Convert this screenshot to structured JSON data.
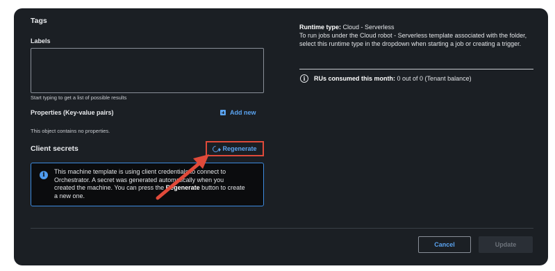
{
  "tags": {
    "title": "Tags"
  },
  "labels": {
    "title": "Labels",
    "hint": "Start typing to get a list of possible results"
  },
  "properties": {
    "title": "Properties (Key-value pairs)",
    "add_label": "Add new",
    "empty_text": "This object contains no properties."
  },
  "client_secrets": {
    "title": "Client secrets",
    "regenerate_label": "Regenerate",
    "info_line1": "This machine template is using client credentials to connect to",
    "info_line2": "Orchestrator. A secret was generated automatically when you",
    "info_line3_pre": "created the machine. You can press the ",
    "info_line3_bold": "Regenerate",
    "info_line3_post": " button to create",
    "info_line4": "a new one."
  },
  "runtime": {
    "label": "Runtime type:",
    "value": "Cloud - Serverless",
    "description": "To run jobs under the Cloud robot - Serverless template associated with the folder, select this runtime type in the dropdown when starting a job or creating a trigger."
  },
  "rus": {
    "label": "RUs consumed this month:",
    "value": "0 out of 0 (Tenant balance)"
  },
  "footer": {
    "cancel_label": "Cancel",
    "update_label": "Update"
  },
  "colors": {
    "panel_bg": "#1b1f24",
    "accent": "#5aa3f0",
    "highlight": "#e04a3a"
  },
  "icons": [
    "add-box-icon",
    "refresh-icon",
    "info-icon",
    "info-circle-icon",
    "arrow-annotation"
  ]
}
